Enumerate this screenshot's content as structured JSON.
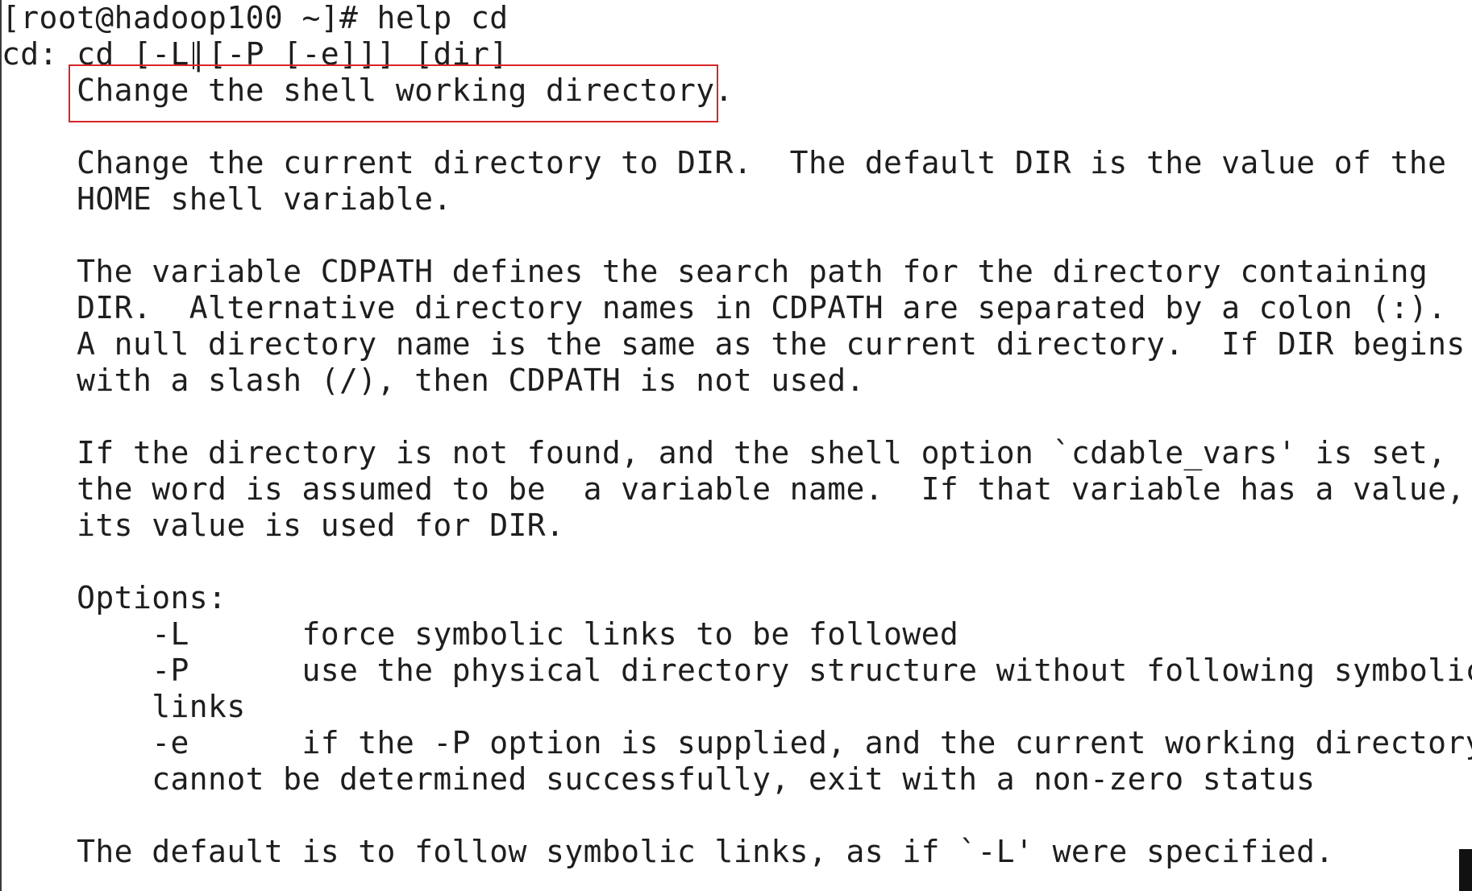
{
  "terminal": {
    "lines": [
      "[root@hadoop100 ~]# help cd",
      "cd: cd [-L|[-P [-e]]] [dir]",
      "    Change the shell working directory.",
      "",
      "    Change the current directory to DIR.  The default DIR is the value of the",
      "    HOME shell variable.",
      "",
      "    The variable CDPATH defines the search path for the directory containing",
      "    DIR.  Alternative directory names in CDPATH are separated by a colon (:).",
      "    A null directory name is the same as the current directory.  If DIR begins",
      "    with a slash (/), then CDPATH is not used.",
      "",
      "    If the directory is not found, and the shell option `cdable_vars' is set,",
      "    the word is assumed to be  a variable name.  If that variable has a value,",
      "    its value is used for DIR.",
      "",
      "    Options:",
      "        -L      force symbolic links to be followed",
      "        -P      use the physical directory structure without following symbolic",
      "        links",
      "        -e      if the -P option is supplied, and the current working directory",
      "        cannot be determined successfully, exit with a non-zero status",
      "",
      "    The default is to follow symbolic links, as if `-L' were specified."
    ]
  },
  "colors": {
    "background": "#ffffff",
    "text": "#1e1e1e",
    "highlight_border": "#d9252a"
  }
}
